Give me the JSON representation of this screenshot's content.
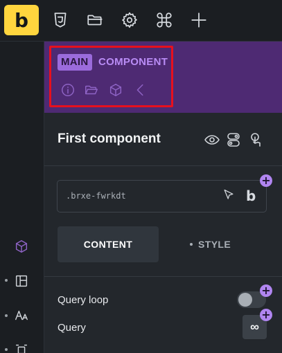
{
  "topbar": {
    "logo_letter": "b",
    "icons": [
      "css3-icon",
      "folder-icon",
      "gear-icon",
      "command-icon",
      "plus-icon"
    ]
  },
  "header": {
    "badge_main": "MAIN",
    "badge_component": "COMPONENT",
    "icons": [
      "info-icon",
      "folder-open-icon",
      "cube-icon",
      "chevron-left-icon"
    ]
  },
  "component": {
    "title": "First component",
    "actions": [
      "eye-icon",
      "toggle-settings-icon",
      "touch-icon"
    ]
  },
  "class_selector": {
    "value": ".brxe-fwrkdt",
    "plus": "+"
  },
  "tabs": {
    "content": "CONTENT",
    "style": "STYLE"
  },
  "controls": {
    "query_loop_label": "Query loop",
    "query_loop_enabled": false,
    "query_label": "Query",
    "query_button": "∞",
    "plus": "+"
  },
  "colors": {
    "accent_purple": "#4e2a73",
    "badge_purple": "#9b6bdc",
    "highlight_red": "#e8101d",
    "logo_yellow": "#ffd53e"
  }
}
